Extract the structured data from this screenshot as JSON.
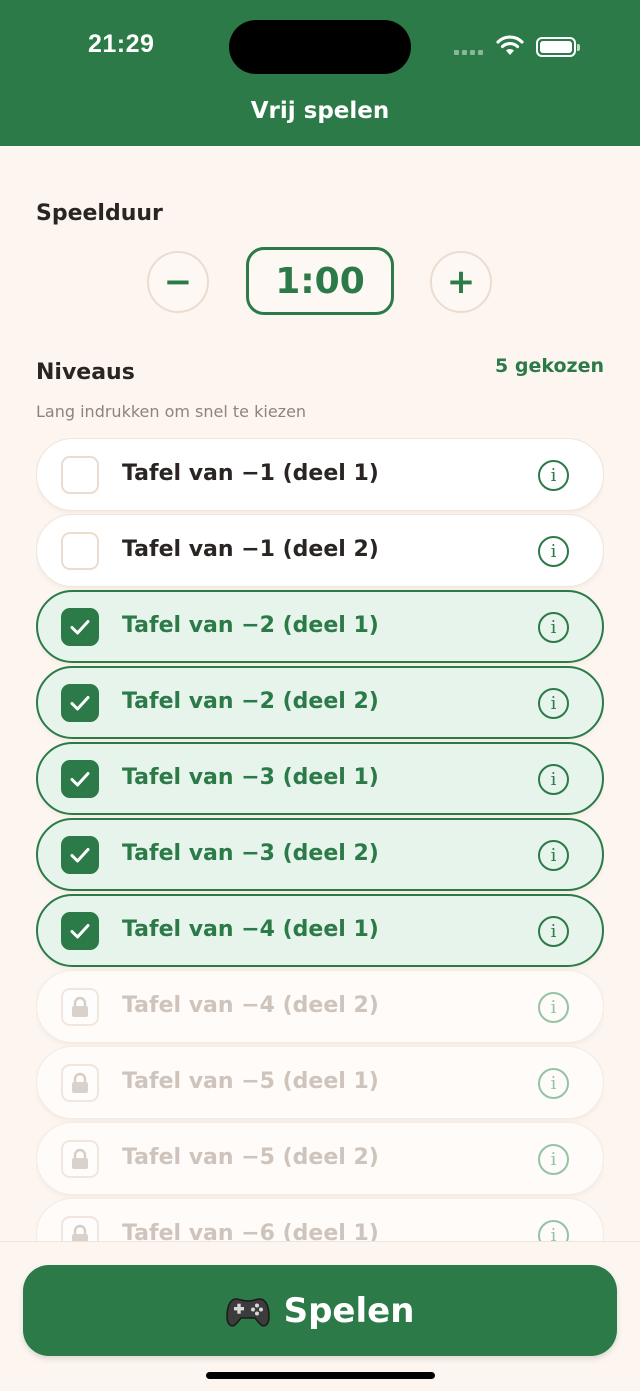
{
  "status": {
    "time": "21:29"
  },
  "nav": {
    "title": "Vrij spelen"
  },
  "duration": {
    "title": "Speelduur",
    "value": "1:00",
    "decrement": "−",
    "increment": "+"
  },
  "levels": {
    "title": "Niveaus",
    "chosen": "5 gekozen",
    "hint": "Lang indrukken om snel te kiezen",
    "items": [
      {
        "label": "Tafel van −1 (deel 1)",
        "state": "unselected"
      },
      {
        "label": "Tafel van −1 (deel 2)",
        "state": "unselected"
      },
      {
        "label": "Tafel van −2 (deel 1)",
        "state": "selected"
      },
      {
        "label": "Tafel van −2 (deel 2)",
        "state": "selected"
      },
      {
        "label": "Tafel van −3 (deel 1)",
        "state": "selected"
      },
      {
        "label": "Tafel van −3 (deel 2)",
        "state": "selected"
      },
      {
        "label": "Tafel van −4 (deel 1)",
        "state": "selected"
      },
      {
        "label": "Tafel van −4 (deel 2)",
        "state": "locked"
      },
      {
        "label": "Tafel van −5 (deel 1)",
        "state": "locked"
      },
      {
        "label": "Tafel van −5 (deel 2)",
        "state": "locked"
      },
      {
        "label": "Tafel van −6 (deel 1)",
        "state": "locked"
      }
    ]
  },
  "play": {
    "label": "Spelen",
    "icon": "gamepad-icon"
  },
  "colors": {
    "accent": "#2b7a48",
    "background": "#fcf5f0",
    "selected_bg": "#e6f4ec"
  }
}
